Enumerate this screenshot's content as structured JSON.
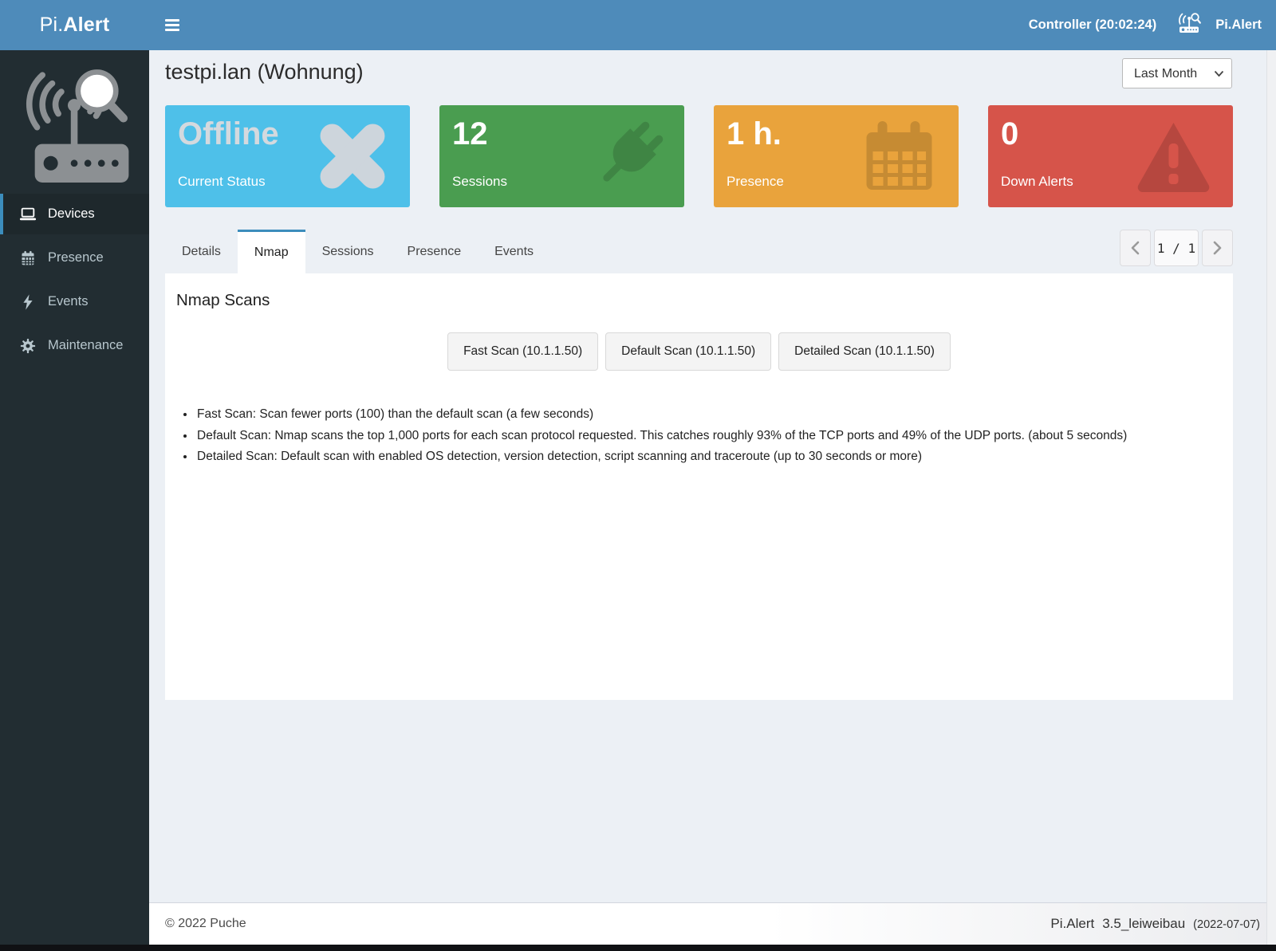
{
  "app": {
    "accent_blue": "#3c8dbc",
    "header_blue": "#4e8bba",
    "sidebar_bg": "#222d32"
  },
  "header": {
    "logo_prefix": "Pi.",
    "logo_suffix": "Alert",
    "controller_label": "Controller (20:02:24)",
    "account_label": "Pi.Alert"
  },
  "sidebar": {
    "items": [
      {
        "label": "Devices",
        "icon": "laptop-icon",
        "active": true
      },
      {
        "label": "Presence",
        "icon": "calendar-icon",
        "active": false
      },
      {
        "label": "Events",
        "icon": "bolt-icon",
        "active": false
      },
      {
        "label": "Maintenance",
        "icon": "gear-icon",
        "active": false
      }
    ]
  },
  "page": {
    "title": "testpi.lan (Wohnung)",
    "period_selected": "Last Month"
  },
  "cards": [
    {
      "value": "Offline",
      "label": "Current Status",
      "color": "#4ec0e9",
      "icon": "x-icon"
    },
    {
      "value": "12",
      "label": "Sessions",
      "color": "#4a9d50",
      "icon": "plug-icon"
    },
    {
      "value": "1 h.",
      "label": "Presence",
      "color": "#e9a33c",
      "icon": "calendar-icon"
    },
    {
      "value": "0",
      "label": "Down Alerts",
      "color": "#d6544a",
      "icon": "warning-triangle-icon"
    }
  ],
  "tabs": {
    "active": "Nmap",
    "items": [
      {
        "label": "Details"
      },
      {
        "label": "Nmap"
      },
      {
        "label": "Sessions"
      },
      {
        "label": "Presence"
      },
      {
        "label": "Events"
      }
    ]
  },
  "pagination": {
    "current": "1 / 1"
  },
  "nmap": {
    "heading": "Nmap Scans",
    "scan_buttons": [
      {
        "label": "Fast Scan (10.1.1.50)"
      },
      {
        "label": "Default Scan (10.1.1.50)"
      },
      {
        "label": "Detailed Scan (10.1.1.50)"
      }
    ],
    "notes": [
      "Fast Scan: Scan fewer ports (100) than the default scan (a few seconds)",
      "Default Scan: Nmap scans the top 1,000 ports for each scan protocol requested. This catches roughly 93% of the TCP ports and 49% of the UDP ports. (about 5 seconds)",
      "Detailed Scan: Default scan with enabled OS detection, version detection, script scanning and traceroute (up to 30 seconds or more)"
    ]
  },
  "footer": {
    "copyright": "© 2022 Puche",
    "app_name": "Pi.Alert",
    "version": "3.5_leiweibau",
    "date": "(2022-07-07)"
  }
}
